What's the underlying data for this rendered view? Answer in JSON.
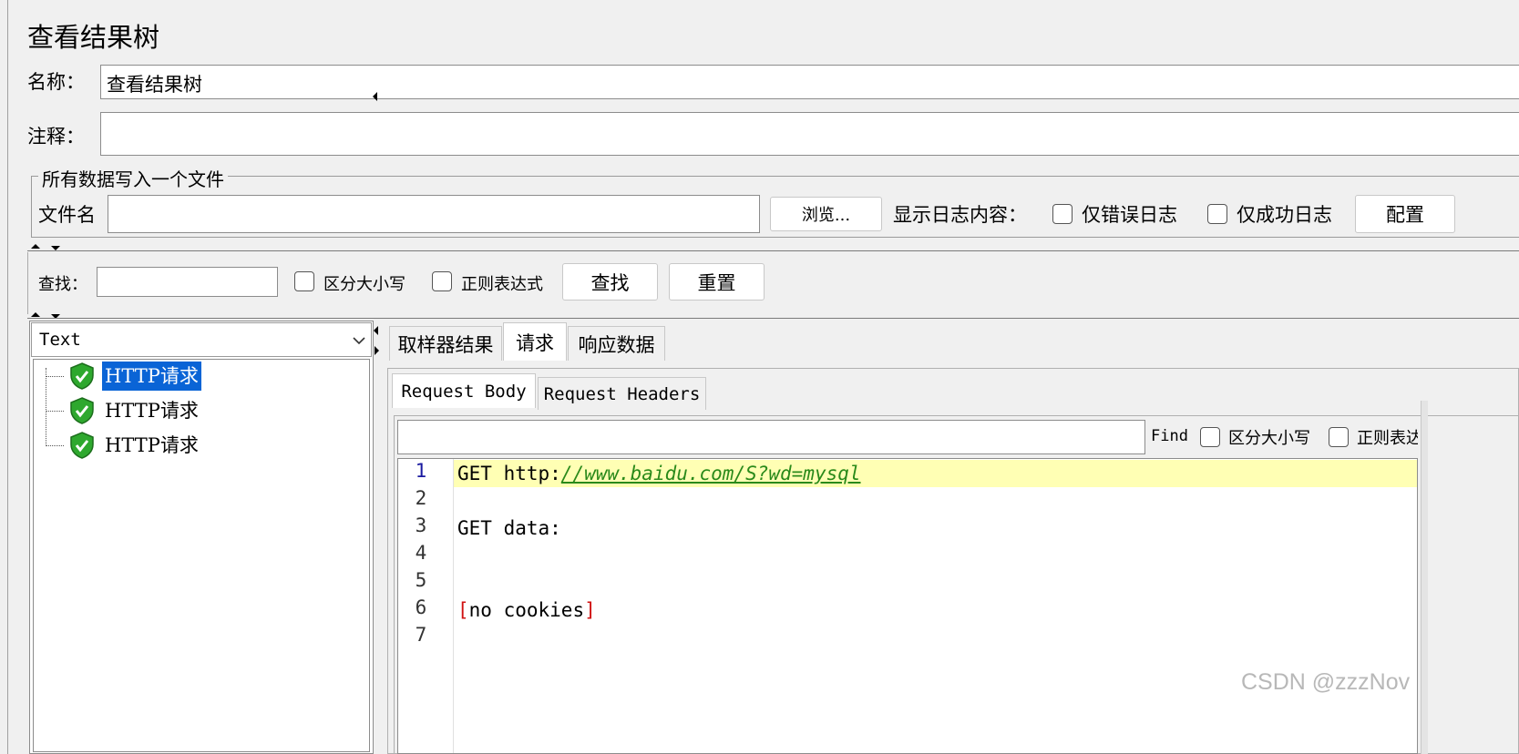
{
  "panel": {
    "title": "查看结果树"
  },
  "form": {
    "name_label": "名称：",
    "name_value": "查看结果树",
    "comment_label": "注释：",
    "comment_value": ""
  },
  "file_group": {
    "legend": "所有数据写入一个文件",
    "filename_label": "文件名",
    "filename_value": "",
    "browse_label": "浏览...",
    "log_label": "显示日志内容：",
    "errors_only_label": "仅错误日志",
    "success_only_label": "仅成功日志",
    "configure_label": "配置"
  },
  "search": {
    "label": "查找：",
    "value": "",
    "case_label": "区分大小写",
    "regex_label": "正则表达式",
    "find_label": "查找",
    "reset_label": "重置"
  },
  "renderer": {
    "selected": "Text"
  },
  "tree": {
    "items": [
      {
        "label": "HTTP请求",
        "selected": true
      },
      {
        "label": "HTTP请求",
        "selected": false
      },
      {
        "label": "HTTP请求",
        "selected": false
      }
    ]
  },
  "result_tabs": [
    {
      "label": "取样器结果"
    },
    {
      "label": "请求",
      "active": true
    },
    {
      "label": "响应数据"
    }
  ],
  "request_tabs": [
    {
      "label": "Request Body",
      "active": true
    },
    {
      "label": "Request Headers"
    }
  ],
  "find_bar": {
    "value": "",
    "find_label": "Find",
    "case_label": "区分大小写",
    "regex_label": "正则表达式"
  },
  "editor": {
    "line_numbers": [
      "1",
      "2",
      "3",
      "4",
      "5",
      "6",
      "7"
    ],
    "line1_prefix": "GET http:",
    "line1_url": "//www.baidu.com/S?wd=mysql",
    "line3": "GET data:",
    "line6_open": "[",
    "line6_text": "no cookies",
    "line6_close": "]"
  },
  "watermark": "CSDN @zzzNov",
  "colors": {
    "selection": "#0a64d6",
    "highlight_line": "#ffffb4",
    "url_green": "#2a8a1a",
    "bracket_red": "#d01010",
    "line_number_active": "#1a1aa0"
  }
}
